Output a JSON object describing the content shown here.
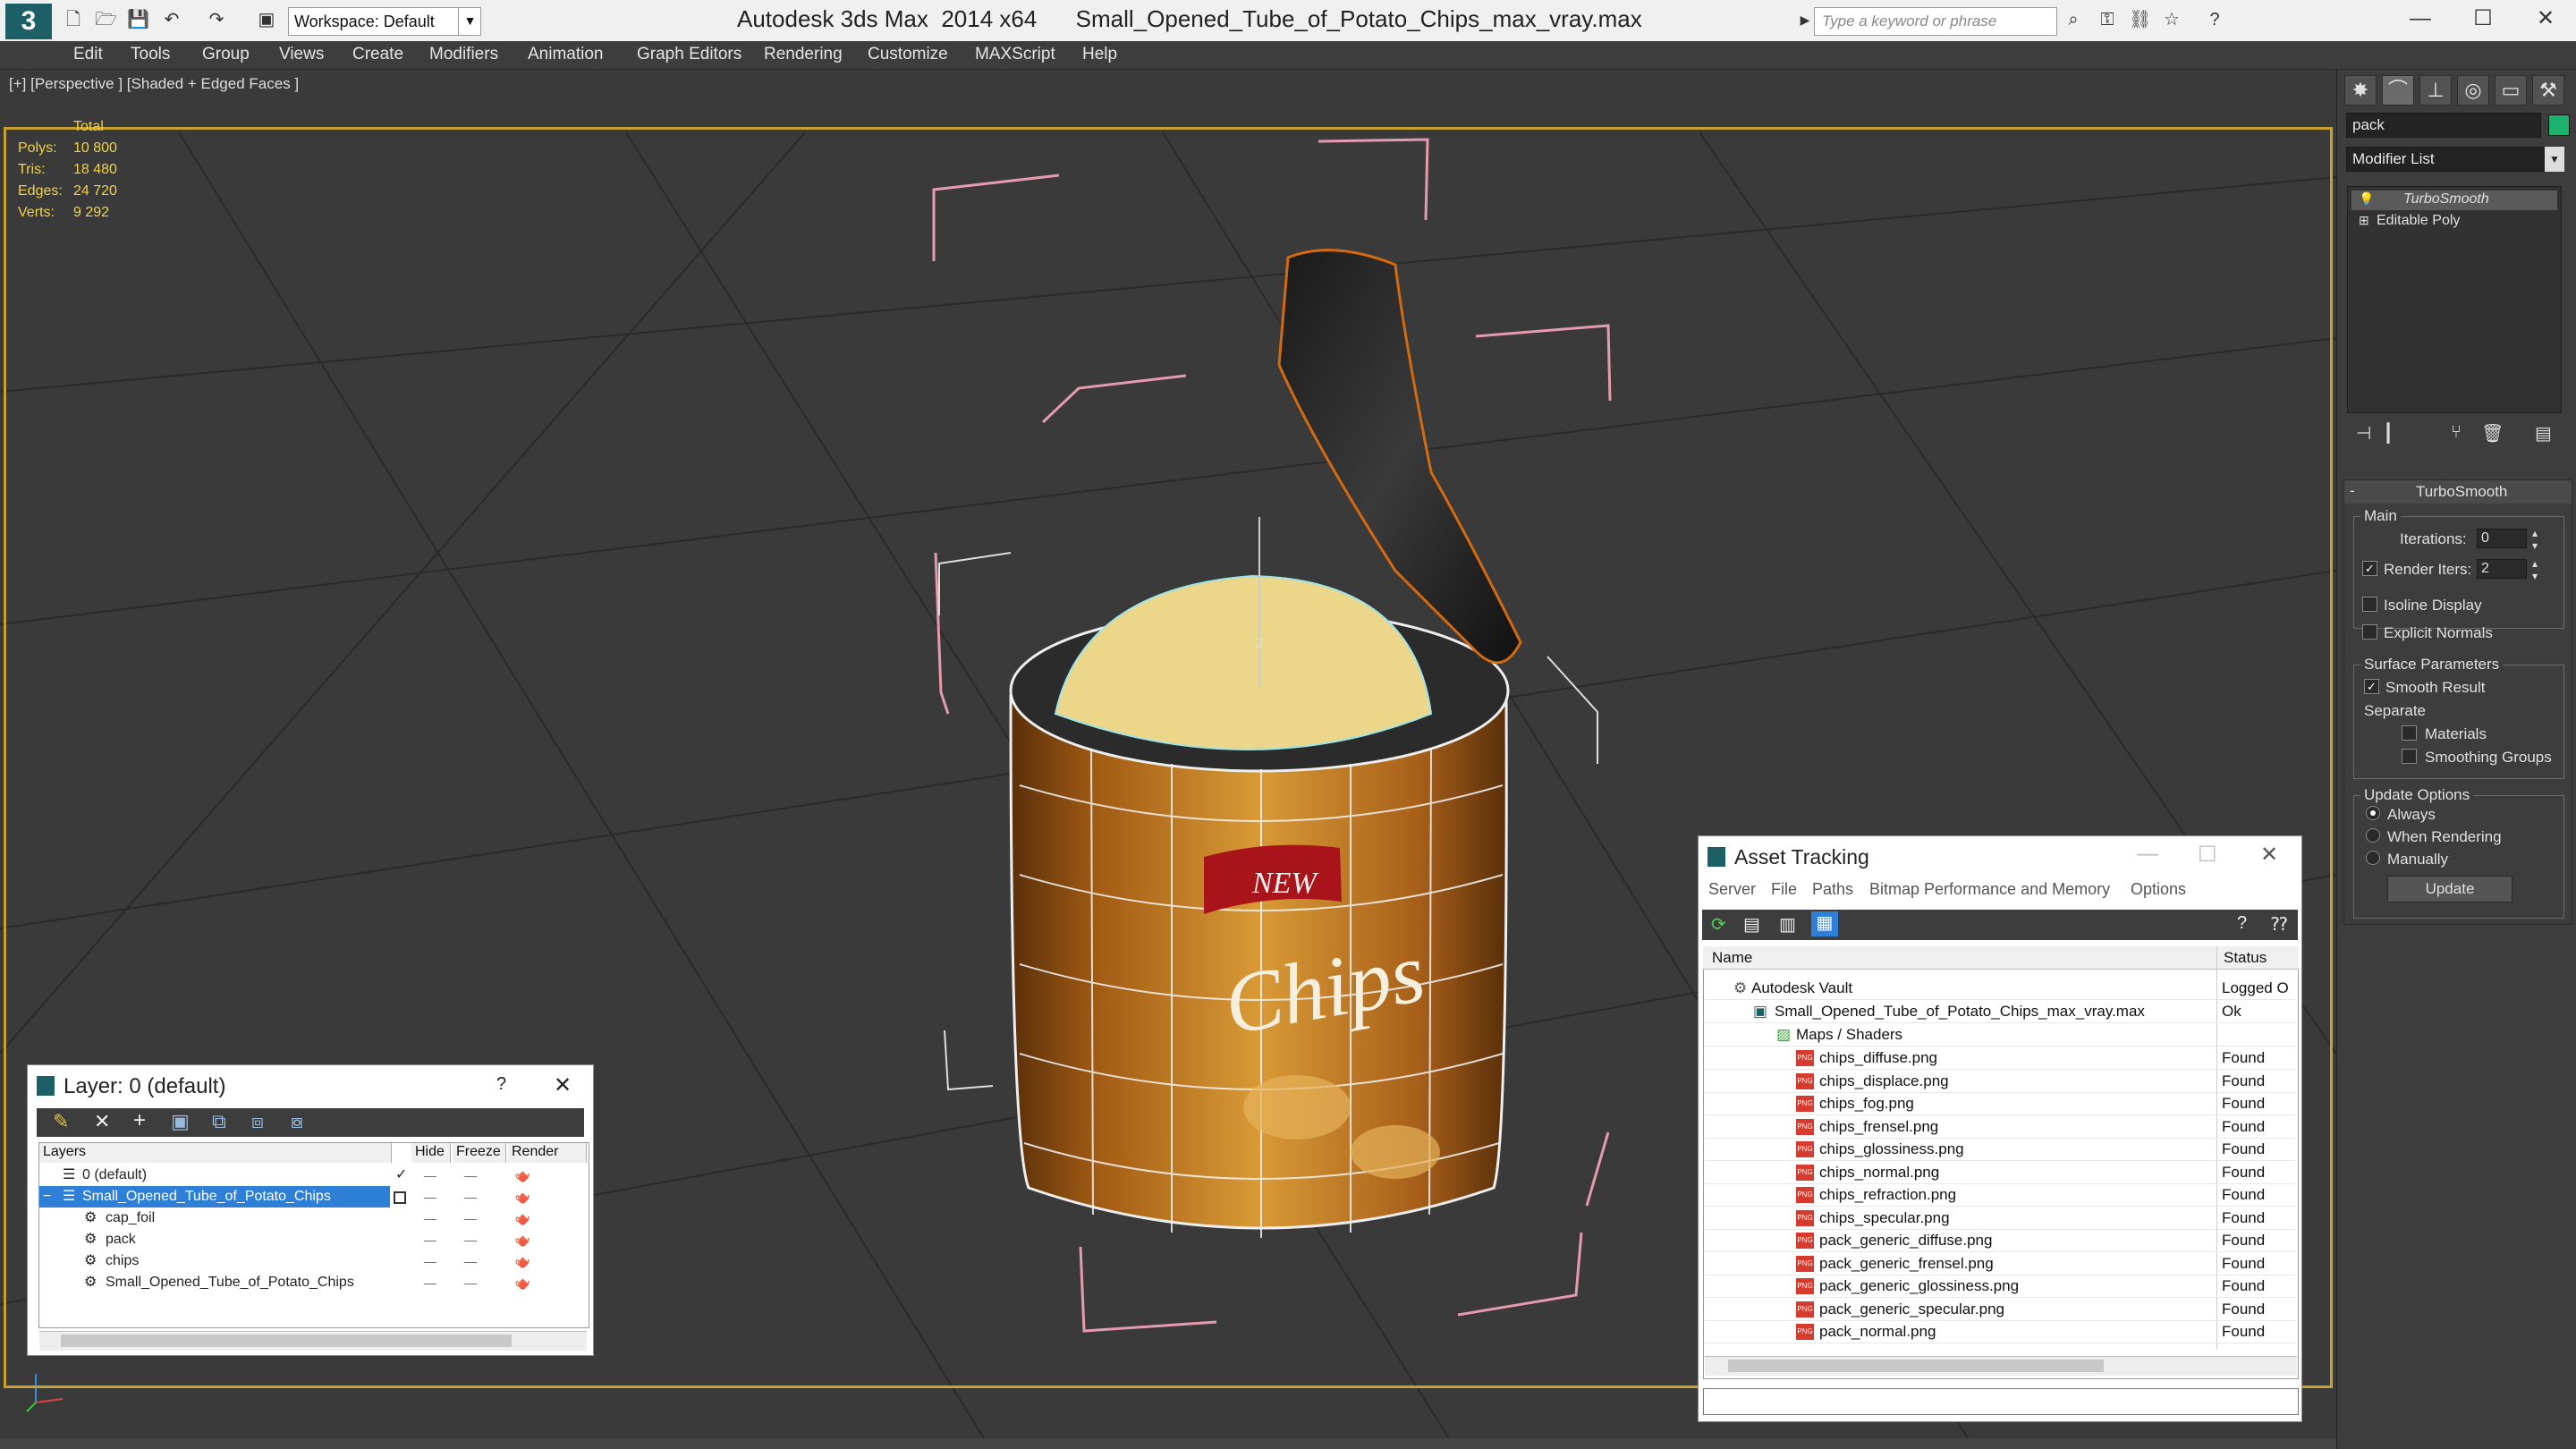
{
  "app": {
    "logo": "3",
    "title": "Autodesk 3ds Max  2014 x64      Small_Opened_Tube_of_Potato_Chips_max_vray.max",
    "workspace": "Workspace: Default",
    "search_placeholder": "Type a keyword or phrase"
  },
  "menu": [
    "Edit",
    "Tools",
    "Group",
    "Views",
    "Create",
    "Modifiers",
    "Animation",
    "Graph Editors",
    "Rendering",
    "Customize",
    "MAXScript",
    "Help"
  ],
  "viewport": {
    "label": "[+] [Perspective ] [Shaded + Edged Faces ]",
    "stats_header": "Total",
    "stats": [
      {
        "k": "Polys:",
        "v": "10 800"
      },
      {
        "k": "Tris:",
        "v": "18 480"
      },
      {
        "k": "Edges:",
        "v": "24 720"
      },
      {
        "k": "Verts:",
        "v": "9 292"
      }
    ],
    "label_new": "NEW",
    "label_chips": "Chips",
    "label_gizmo": "Z"
  },
  "command_panel": {
    "object_name": "pack",
    "modifier_list": "Modifier List",
    "stack": [
      "TurboSmooth",
      "Editable Poly"
    ],
    "rollout_title": "TurboSmooth",
    "main_label": "Main",
    "iterations_label": "Iterations:",
    "iterations_value": "0",
    "render_iters_label": "Render Iters:",
    "render_iters_value": "2",
    "isoline": "Isoline Display",
    "explicit_normals": "Explicit Normals",
    "surface_params": "Surface Parameters",
    "smooth_result": "Smooth Result",
    "separate": "Separate",
    "materials": "Materials",
    "smoothing_groups": "Smoothing Groups",
    "update_options": "Update Options",
    "always": "Always",
    "when_rendering": "When Rendering",
    "manually": "Manually",
    "update_btn": "Update"
  },
  "layer_dialog": {
    "title": "Layer: 0 (default)",
    "help": "?",
    "close": "✕",
    "columns": [
      "Layers",
      "Hide",
      "Freeze",
      "Render"
    ],
    "rows": [
      {
        "name": "0 (default)",
        "indent": 0
      },
      {
        "name": "Small_Opened_Tube_of_Potato_Chips",
        "indent": 0
      },
      {
        "name": "cap_foil",
        "indent": 1
      },
      {
        "name": "pack",
        "indent": 1
      },
      {
        "name": "chips",
        "indent": 1
      },
      {
        "name": "Small_Opened_Tube_of_Potato_Chips",
        "indent": 1
      }
    ]
  },
  "asset_tracking": {
    "title": "Asset Tracking",
    "menu": [
      "Server",
      "File",
      "Paths",
      "Bitmap Performance and Memory",
      "Options"
    ],
    "col_name": "Name",
    "col_status": "Status",
    "vault": {
      "name": "Autodesk Vault",
      "status": "Logged O"
    },
    "file": {
      "name": "Small_Opened_Tube_of_Potato_Chips_max_vray.max",
      "status": "Ok"
    },
    "maps_folder": "Maps / Shaders",
    "maps": [
      {
        "name": "chips_diffuse.png",
        "status": "Found"
      },
      {
        "name": "chips_displace.png",
        "status": "Found"
      },
      {
        "name": "chips_fog.png",
        "status": "Found"
      },
      {
        "name": "chips_frensel.png",
        "status": "Found"
      },
      {
        "name": "chips_glossiness.png",
        "status": "Found"
      },
      {
        "name": "chips_normal.png",
        "status": "Found"
      },
      {
        "name": "chips_refraction.png",
        "status": "Found"
      },
      {
        "name": "chips_specular.png",
        "status": "Found"
      },
      {
        "name": "pack_generic_diffuse.png",
        "status": "Found"
      },
      {
        "name": "pack_generic_frensel.png",
        "status": "Found"
      },
      {
        "name": "pack_generic_glossiness.png",
        "status": "Found"
      },
      {
        "name": "pack_generic_specular.png",
        "status": "Found"
      },
      {
        "name": "pack_normal.png",
        "status": "Found"
      }
    ]
  }
}
